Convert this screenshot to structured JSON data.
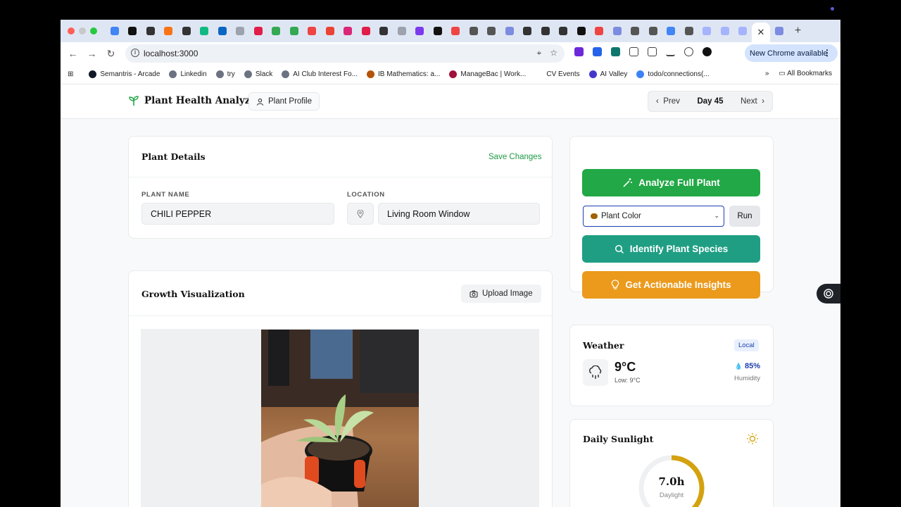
{
  "browser": {
    "url": "localhost:3000",
    "update_label": "New Chrome available",
    "new_tab_symbol": "+",
    "close_tab_symbol": "✕"
  },
  "bookmarks": {
    "items": [
      {
        "label": "Semantris - Arcade",
        "color": "#111827"
      },
      {
        "label": "Linkedin",
        "color": "#6b7280"
      },
      {
        "label": "try",
        "color": "#6b7280"
      },
      {
        "label": "Slack",
        "color": "#6b7280"
      },
      {
        "label": "AI Club Interest Fo...",
        "color": "#6b7280"
      },
      {
        "label": "IB Mathematics: a...",
        "color": "#b45309"
      },
      {
        "label": "ManageBac | Work...",
        "color": "#9f1239"
      },
      {
        "label": "CV Events",
        "color": "#ffffff"
      },
      {
        "label": "AI Valley",
        "color": "#4338ca"
      },
      {
        "label": "todo/connections(...",
        "color": "#3b82f6"
      }
    ],
    "all_bookmarks": "All Bookmarks"
  },
  "app": {
    "title": "Plant Health Analyzer",
    "profile_button": "Plant Profile",
    "nav": {
      "prev": "Prev",
      "day": "Day 45",
      "next": "Next"
    }
  },
  "plant_details": {
    "title": "Plant Details",
    "save": "Save Changes",
    "name_label": "PLANT NAME",
    "name_value": "CHILI PEPPER",
    "location_label": "LOCATION",
    "location_value": "Living Room Window"
  },
  "growth": {
    "title": "Growth Visualization",
    "upload": "Upload Image"
  },
  "actions": {
    "analyze": "Analyze Full Plant",
    "select_value": "Plant Color",
    "run": "Run",
    "identify": "Identify Plant Species",
    "insights": "Get Actionable Insights",
    "colors": {
      "analyze": "#22a846",
      "identify": "#1f9e83",
      "insights": "#eb9a1c"
    }
  },
  "weather": {
    "title": "Weather",
    "badge": "Local",
    "temp": "9°C",
    "low": "Low: 9°C",
    "humidity": "85%",
    "humidity_label": "Humidity"
  },
  "sunlight": {
    "title": "Daily Sunlight",
    "hours": "7.0h",
    "label": "Daylight"
  }
}
